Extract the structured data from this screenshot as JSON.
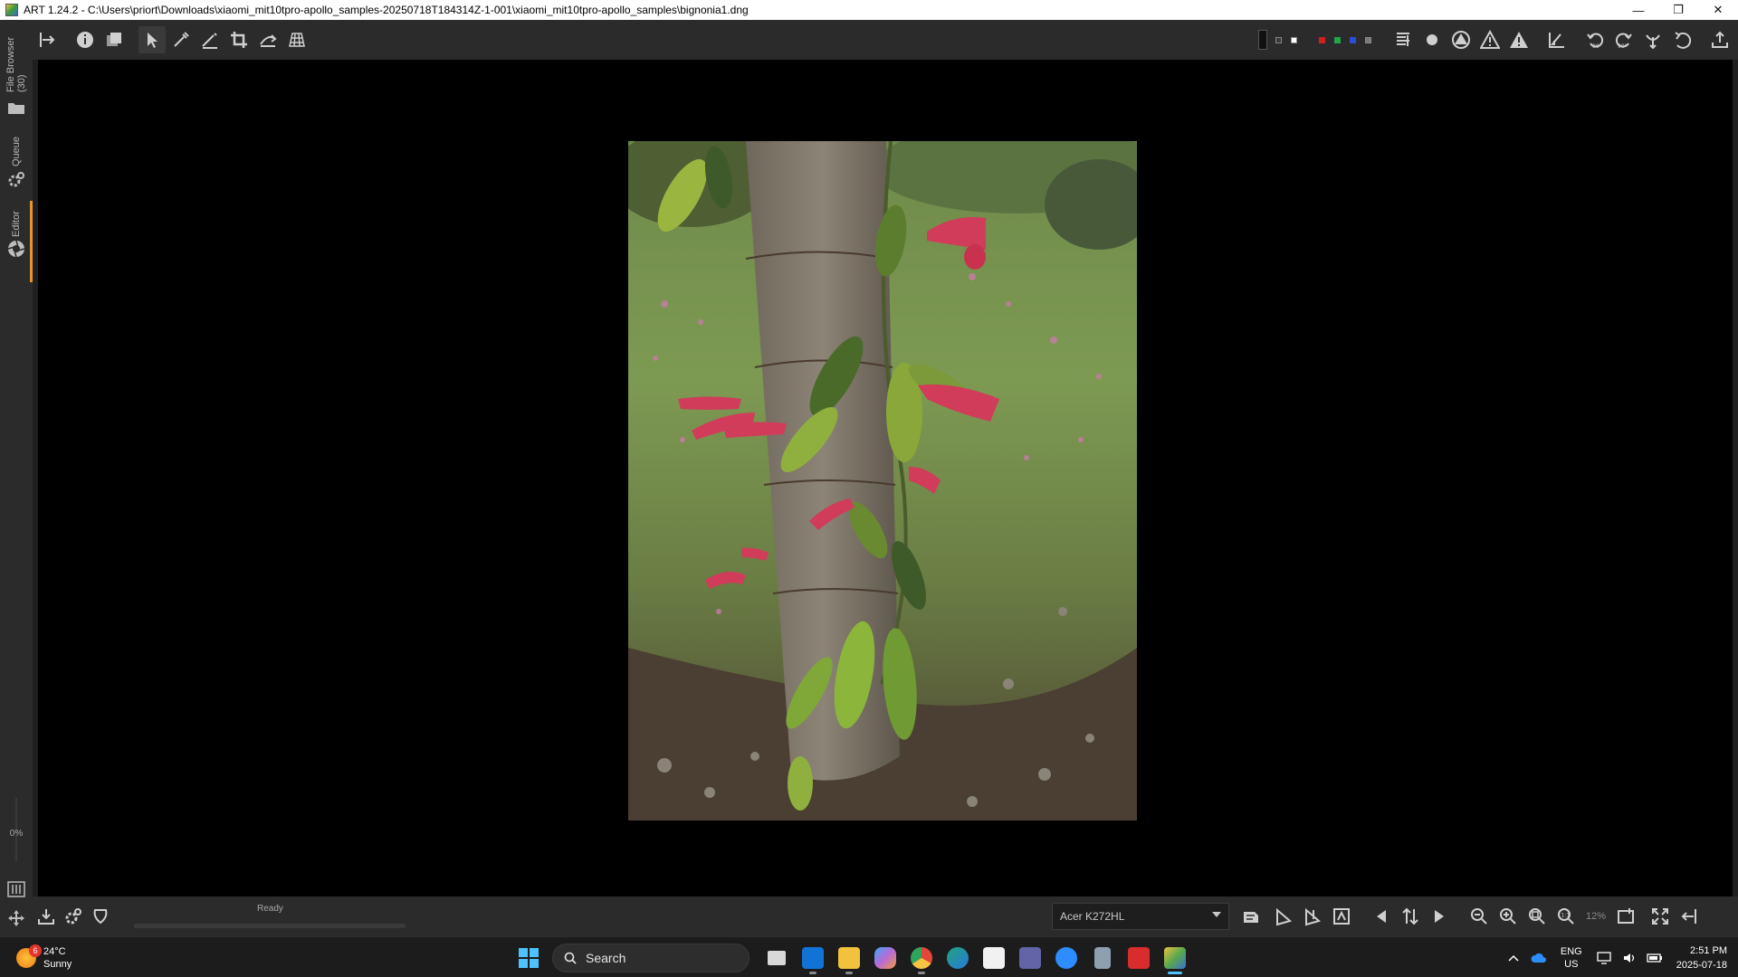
{
  "window": {
    "title": "ART 1.24.2 - C:\\Users\\priort\\Downloads\\xiaomi_mit10tpro-apollo_samples-20250718T184314Z-1-001\\xiaomi_mit10tpro-apollo_samples\\bignonia1.dng",
    "controls": [
      "minimize-icon",
      "restore-icon",
      "close-icon"
    ]
  },
  "left_panel": {
    "tabs": [
      {
        "label": "File Browser (30)",
        "icon": "folder-icon"
      },
      {
        "label": "Queue",
        "icon": "gears-icon"
      },
      {
        "label": "Editor",
        "icon": "aperture-icon",
        "active": true
      }
    ],
    "progress_label": "0%",
    "accent_color": "#e8942a"
  },
  "toolbar": {
    "left_tools": [
      "toggle-panel-icon",
      "info-icon",
      "before-after-icon",
      "hand-tool-icon",
      "white-balance-picker-icon",
      "straighten-icon",
      "crop-icon",
      "perspective-icon",
      "grid-icon"
    ],
    "active_tool": "hand-tool-icon",
    "right_tools": [
      "background-dark-icon",
      "bg-grey-icon",
      "bg-white-icon",
      "channel-red-icon",
      "channel-green-icon",
      "channel-blue-icon",
      "channel-lum-icon",
      "focus-mask-icon",
      "preview-circle-icon",
      "shadow-clip-icon",
      "highlight-clip-icon",
      "warning-icon",
      "histogram-icon",
      "rotate-left-icon",
      "rotate-right-icon",
      "flip-icon",
      "undo-icon",
      "export-icon"
    ],
    "swatch_colors": [
      "#000000",
      "#ffffff",
      "#d21f1f",
      "#22a44a",
      "#2a4fd6",
      "#7a7a7a"
    ]
  },
  "canvas": {
    "image_name": "bignonia1.dng"
  },
  "status": {
    "text": "Ready",
    "monitor_profile": "Acer K272HL",
    "zoom_label": "12%"
  },
  "taskbar": {
    "weather": {
      "temp": "24°C",
      "condition": "Sunny",
      "badge": "6"
    },
    "search_placeholder": "Search",
    "apps": [
      {
        "name": "task-view",
        "color": "#d8d8d8"
      },
      {
        "name": "outlook",
        "color": "#1273d6"
      },
      {
        "name": "file-explorer",
        "color": "#f3c23c"
      },
      {
        "name": "copilot",
        "color": "#b86ad8"
      },
      {
        "name": "chrome",
        "color": "#e3463a"
      },
      {
        "name": "edge",
        "color": "#1fa37f"
      },
      {
        "name": "ms-store",
        "color": "#f1f1f1"
      },
      {
        "name": "teams",
        "color": "#6264a7"
      },
      {
        "name": "zoom",
        "color": "#2d8cff"
      },
      {
        "name": "calculator",
        "color": "#8ea0b0"
      },
      {
        "name": "pdf-app",
        "color": "#d92d2d"
      },
      {
        "name": "art",
        "color": "#5aa84a"
      }
    ],
    "active_app": "art",
    "lang_top": "ENG",
    "lang_bottom": "US",
    "time": "2:51 PM",
    "date": "2025-07-18"
  }
}
